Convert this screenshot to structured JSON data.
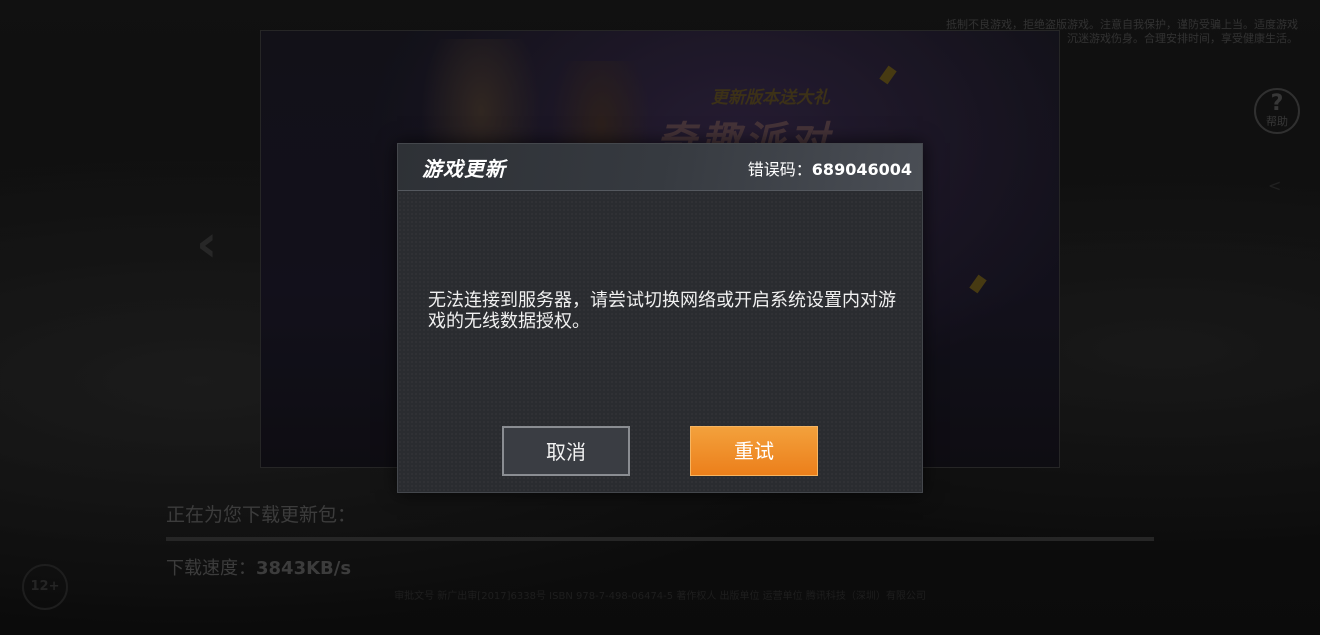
{
  "background": {
    "health_notice": "抵制不良游戏，拒绝盗版游戏。注意自我保护，谨防受骗上当。适度游戏益脑，沉迷游戏伤身。合理安排时间，享受健康生活。",
    "help_button": {
      "icon": "question-icon",
      "label": "帮助"
    },
    "banner": {
      "subtitle": "更新版本送大礼",
      "title": "奇趣派对"
    },
    "download": {
      "status_label": "正在为您下载更新包：",
      "progress_fraction": 0.0,
      "speed_label": "下载速度：",
      "speed_value": "3843KB/s"
    },
    "footer_text": "审批文号 新广出审[2017]6338号 ISBN 978-7-498-06474-5 著作权人 出版单位 运营单位 腾讯科技（深圳）有限公司"
  },
  "dialog": {
    "title": "游戏更新",
    "error_label": "错误码：",
    "error_code": "689046004",
    "message": "无法连接到服务器，请尝试切换网络或开启系统设置内对游戏的无线数据授权。",
    "cancel_label": "取消",
    "retry_label": "重试",
    "colors": {
      "retry_button": "#EE8A25",
      "panel": "#2A2C30"
    }
  }
}
